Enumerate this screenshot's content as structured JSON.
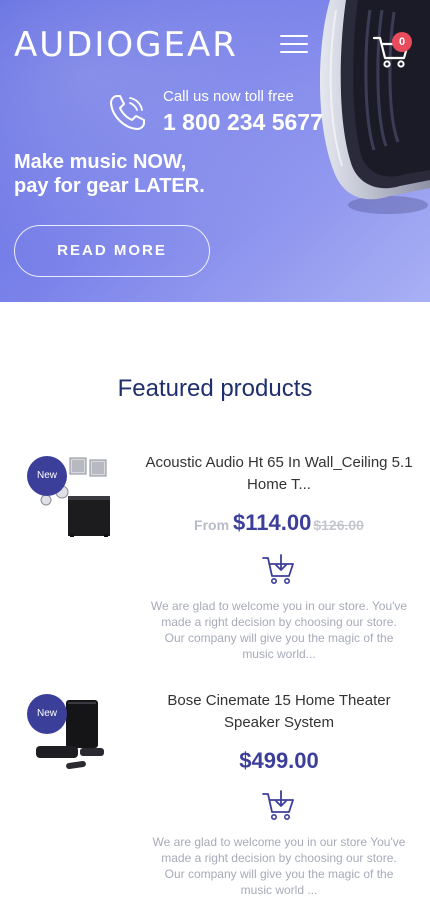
{
  "header": {
    "logo": "AUDIOGEAR",
    "cart_count": "0",
    "phone_caption": "Call us now toll free",
    "phone_number": "1 800 234 5677",
    "slogan_line1": "Make music NOW,",
    "slogan_line2": "pay for gear LATER.",
    "read_more_label": "READ MORE"
  },
  "featured": {
    "title": "Featured products",
    "products": [
      {
        "badge": "New",
        "name": "Acoustic Audio Ht 65 In Wall_Ceiling 5.1 Home T...",
        "price_from": "From",
        "price": "$114.00",
        "old_price": "$126.00",
        "description": "We are glad to welcome you in our store. You've made a right decision by choosing our store. Our company will give you the magic of the music world..."
      },
      {
        "badge": "New",
        "name": "Bose Cinemate 15 Home Theater Speaker System",
        "price": "$499.00",
        "description": "We are glad to welcome you in our store You've made a right decision by choosing our store. Our company will give you the magic of the music world ..."
      }
    ]
  },
  "colors": {
    "accent": "#3c3f9a",
    "title": "#1f2f6e",
    "badge_red": "#e84b5b",
    "hero_start": "#5f6ae0"
  },
  "icons": {
    "menu": "hamburger-icon",
    "cart": "shopping-cart-icon",
    "phone": "phone-icon",
    "add_to_cart": "add-to-cart-icon"
  }
}
